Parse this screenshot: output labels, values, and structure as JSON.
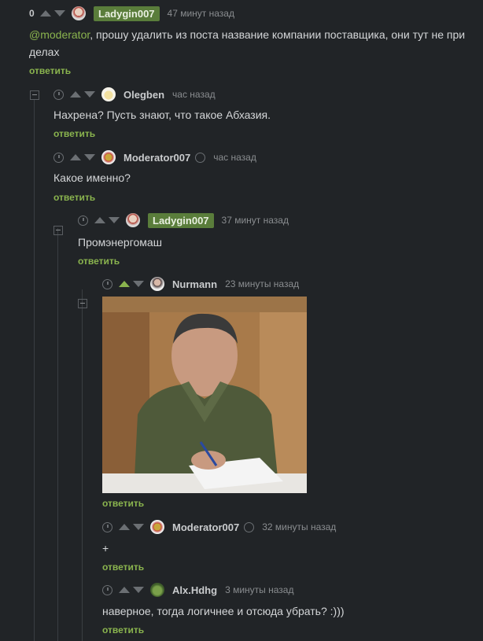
{
  "comments": [
    {
      "rating": "0",
      "author": "Ladygin007",
      "time": "47 минут назад",
      "mention": "@moderator",
      "text": ", прошу удалить из поста название компании поставщика, они тут не при делах",
      "reply": "ответить"
    },
    {
      "author": "Olegben",
      "time": "час назад",
      "text": "Нахрена? Пусть знают, что такое Абхазия.",
      "reply": "ответить"
    },
    {
      "author": "Moderator007",
      "time": "час назад",
      "text": "Какое именно?",
      "reply": "ответить"
    },
    {
      "author": "Ladygin007",
      "time": "37 минут назад",
      "text": "Промэнергомаш",
      "reply": "ответить"
    },
    {
      "author": "Nurmann",
      "time": "23 минуты назад",
      "image": "photo-man-writing",
      "reply": "ответить"
    },
    {
      "author": "Moderator007",
      "time": "32 минуты назад",
      "text": "+",
      "reply": "ответить"
    },
    {
      "author": "Alx.Hdhg",
      "time": "3 минуты назад",
      "text": "наверное, тогда логичнее и отсюда убрать? :)))",
      "reply": "ответить"
    }
  ],
  "colors": {
    "accent": "#8ab44e",
    "badge": "#5a7d3b",
    "background": "#212427"
  }
}
